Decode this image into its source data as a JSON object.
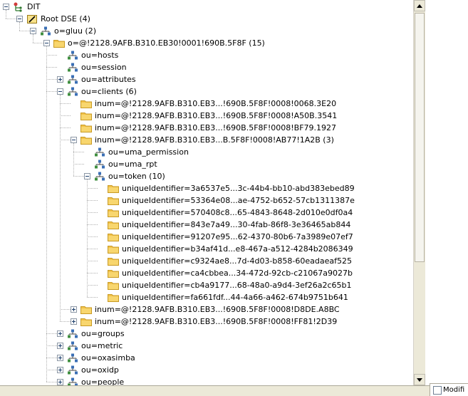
{
  "tree": {
    "rows": [
      {
        "label": "DIT",
        "icon": "dit-icon",
        "twisty": "minus",
        "level": 0
      },
      {
        "label": "Root DSE (4)",
        "icon": "root-dse-icon",
        "twisty": "minus",
        "level": 1
      },
      {
        "label": "o=gluu (2)",
        "icon": "ldap-entry-icon",
        "twisty": "minus",
        "level": 2
      },
      {
        "label": "o=@!2128.9AFB.B310.EB30!0001!690B.5F8F (15)",
        "icon": "folder-icon",
        "twisty": "minus",
        "level": 3
      },
      {
        "label": "ou=hosts",
        "icon": "ldap-entry-icon",
        "twisty": "none",
        "level": 4
      },
      {
        "label": "ou=session",
        "icon": "ldap-entry-icon",
        "twisty": "none",
        "level": 4
      },
      {
        "label": "ou=attributes",
        "icon": "ldap-entry-icon",
        "twisty": "plus",
        "level": 4
      },
      {
        "label": "ou=clients (6)",
        "icon": "ldap-entry-icon",
        "twisty": "minus",
        "level": 4
      },
      {
        "label": "inum=@!2128.9AFB.B310.EB3...!690B.5F8F!0008!0068.3E20",
        "icon": "folder-icon",
        "twisty": "none",
        "level": 5
      },
      {
        "label": "inum=@!2128.9AFB.B310.EB3...!690B.5F8F!0008!A50B.3541",
        "icon": "folder-icon",
        "twisty": "none",
        "level": 5
      },
      {
        "label": "inum=@!2128.9AFB.B310.EB3...!690B.5F8F!0008!BF79.1927",
        "icon": "folder-icon",
        "twisty": "none",
        "level": 5
      },
      {
        "label": "inum=@!2128.9AFB.B310.EB3...B.5F8F!0008!AB77!1A2B (3)",
        "icon": "folder-icon",
        "twisty": "minus",
        "level": 5
      },
      {
        "label": "ou=uma_permission",
        "icon": "ldap-entry-icon",
        "twisty": "none",
        "level": 6
      },
      {
        "label": "ou=uma_rpt",
        "icon": "ldap-entry-icon",
        "twisty": "none",
        "level": 6
      },
      {
        "label": "ou=token (10)",
        "icon": "ldap-entry-icon",
        "twisty": "minus",
        "level": 6
      },
      {
        "label": "uniqueIdentifier=3a6537e5...3c-44b4-bb10-abd383ebed89",
        "icon": "folder-icon",
        "twisty": "none",
        "level": 7
      },
      {
        "label": "uniqueIdentifier=53364e08...ae-4752-b652-57cb1311387e",
        "icon": "folder-icon",
        "twisty": "none",
        "level": 7
      },
      {
        "label": "uniqueIdentifier=570408c8...65-4843-8648-2d010e0df0a4",
        "icon": "folder-icon",
        "twisty": "none",
        "level": 7
      },
      {
        "label": "uniqueIdentifier=843e7a49...30-4fab-86f8-3e36465ab844",
        "icon": "folder-icon",
        "twisty": "none",
        "level": 7
      },
      {
        "label": "uniqueIdentifier=91207e95...62-4370-80b6-7a3989e07ef7",
        "icon": "folder-icon",
        "twisty": "none",
        "level": 7
      },
      {
        "label": "uniqueIdentifier=b34af41d...e8-467a-a512-4284b2086349",
        "icon": "folder-icon",
        "twisty": "none",
        "level": 7
      },
      {
        "label": "uniqueIdentifier=c9324ae8...7d-4d03-b858-60eadaeaf525",
        "icon": "folder-icon",
        "twisty": "none",
        "level": 7
      },
      {
        "label": "uniqueIdentifier=ca4cbbea...34-472d-92cb-c21067a9027b",
        "icon": "folder-icon",
        "twisty": "none",
        "level": 7
      },
      {
        "label": "uniqueIdentifier=cb4a9177...68-48a0-a9d4-3ef26a2c65b1",
        "icon": "folder-icon",
        "twisty": "none",
        "level": 7
      },
      {
        "label": "uniqueIdentifier=fa661fdf...44-4a66-a462-674b9751b641",
        "icon": "folder-icon",
        "twisty": "none",
        "level": 7
      },
      {
        "label": "inum=@!2128.9AFB.B310.EB3...!690B.5F8F!0008!D8DE.A8BC",
        "icon": "folder-icon",
        "twisty": "plus",
        "level": 5
      },
      {
        "label": "inum=@!2128.9AFB.B310.EB3...!690B.5F8F!0008!FF81!2D39",
        "icon": "folder-icon",
        "twisty": "plus",
        "level": 5
      },
      {
        "label": "ou=groups",
        "icon": "ldap-entry-icon",
        "twisty": "plus",
        "level": 4
      },
      {
        "label": "ou=metric",
        "icon": "ldap-entry-icon",
        "twisty": "plus",
        "level": 4
      },
      {
        "label": "ou=oxasimba",
        "icon": "ldap-entry-icon",
        "twisty": "plus",
        "level": 4
      },
      {
        "label": "ou=oxidp",
        "icon": "ldap-entry-icon",
        "twisty": "plus",
        "level": 4
      },
      {
        "label": "ou=people",
        "icon": "ldap-entry-icon",
        "twisty": "plus",
        "level": 4
      }
    ]
  },
  "bottom_tab": {
    "label": "Modifi"
  },
  "colors": {
    "folder": "#f2c24a",
    "folder_dark": "#c89a24",
    "entry_blue": "#3a6fb5",
    "entry_green": "#3f8f3f",
    "scrollbar": "#ece9d8"
  }
}
